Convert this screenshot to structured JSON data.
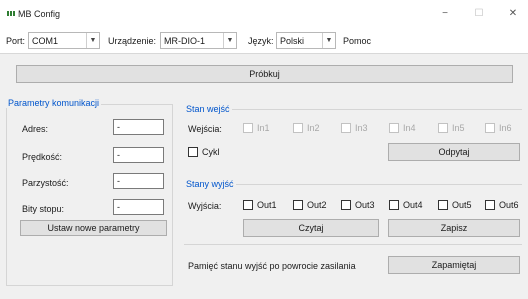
{
  "window": {
    "title": "MB Config",
    "minimize": "−",
    "maximize": "☐",
    "close": "✕"
  },
  "toolbar": {
    "port_label": "Port:",
    "port_value": "COM1",
    "device_label": "Urządzenie:",
    "device_value": "MR-DIO-1",
    "language_label": "Język:",
    "language_value": "Polski",
    "help_label": "Pomoc"
  },
  "try_button": "Próbkuj",
  "comm_params": {
    "title": "Parametry komunikacji",
    "fields": [
      {
        "label": "Adres:",
        "value": "-"
      },
      {
        "label": "Prędkość:",
        "value": "-"
      },
      {
        "label": "Parzystość:",
        "value": "-"
      },
      {
        "label": "Bity stopu:",
        "value": "-"
      }
    ],
    "set_button": "Ustaw nowe parametry"
  },
  "inputs_state": {
    "title": "Stan wejść",
    "label": "Wejścia:",
    "items": [
      "In1",
      "In2",
      "In3",
      "In4",
      "In5",
      "In6"
    ],
    "cycle_label": "Cykl",
    "poll_button": "Odpytaj"
  },
  "outputs_state": {
    "title": "Stany wyjść",
    "label": "Wyjścia:",
    "items": [
      "Out1",
      "Out2",
      "Out3",
      "Out4",
      "Out5",
      "Out6"
    ],
    "read_button": "Czytaj",
    "write_button": "Zapisz"
  },
  "memory": {
    "label": "Pamięć stanu wyjść po powrocie zasilania",
    "button": "Zapamiętaj"
  }
}
